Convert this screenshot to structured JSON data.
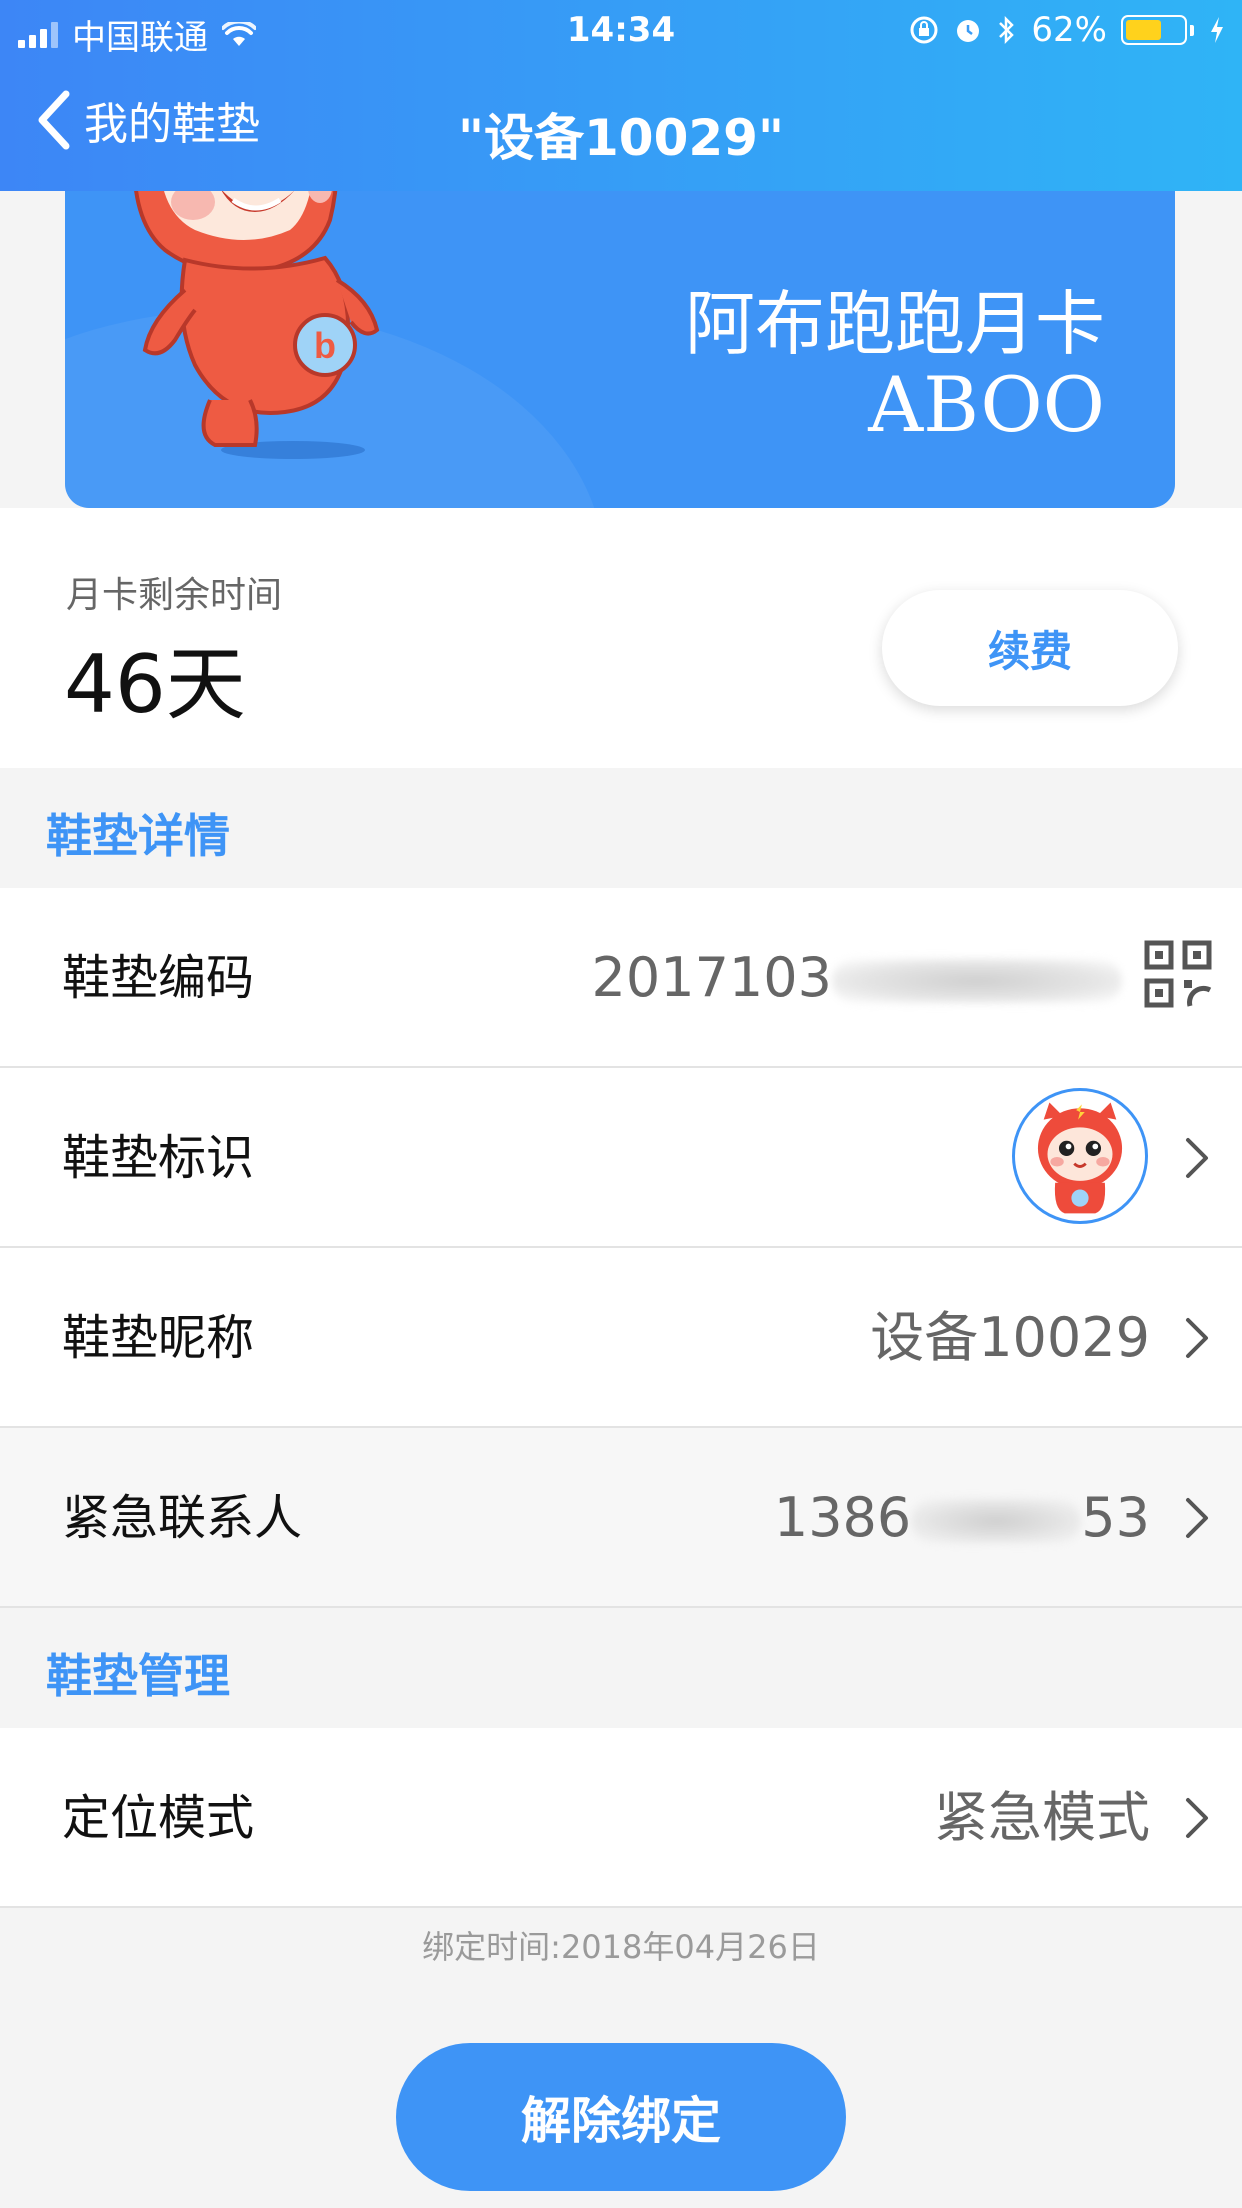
{
  "status_bar": {
    "carrier": "中国联通",
    "time": "14:34",
    "battery": "62%",
    "battery_level": 0.62
  },
  "nav": {
    "back_label": "我的鞋垫",
    "title": "\"设备10029\""
  },
  "card": {
    "title": "阿布跑跑月卡",
    "subtitle": "ABOO"
  },
  "remaining": {
    "label": "月卡剩余时间",
    "value": "46天",
    "renew_label": "续费"
  },
  "details_section": {
    "title": "鞋垫详情",
    "rows": [
      {
        "label": "鞋垫编码",
        "value": "2017103"
      },
      {
        "label": "鞋垫标识"
      },
      {
        "label": "鞋垫昵称",
        "value": "设备10029"
      },
      {
        "label": "紧急联系人",
        "value_start": "1386",
        "value_end": "53"
      }
    ]
  },
  "manage_section": {
    "title": "鞋垫管理",
    "rows": [
      {
        "label": "定位模式",
        "value": "紧急模式"
      }
    ]
  },
  "bind_time": "绑定时间:2018年04月26日",
  "unbind_label": "解除绑定"
}
